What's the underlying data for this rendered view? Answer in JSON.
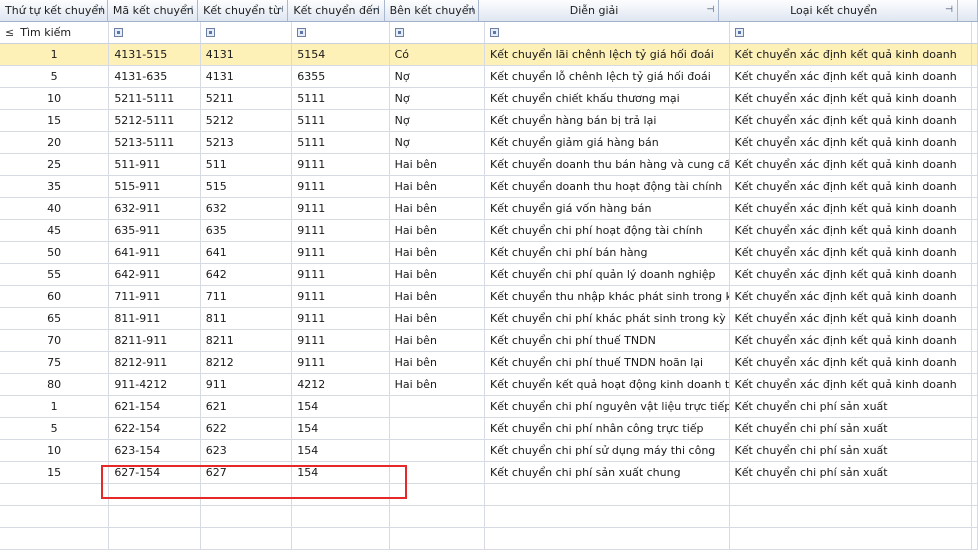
{
  "columns": [
    "Thứ tự kết chuyển",
    "Mã kết chuyển",
    "Kết chuyển từ",
    "Kết chuyển đến",
    "Bên kết chuyển",
    "Diễn giải",
    "Loại kết chuyển"
  ],
  "filter": {
    "operator": "≤",
    "placeholder": "Tìm kiếm"
  },
  "rows": [
    {
      "order": "1",
      "code": "4131-515",
      "from": "4131",
      "to": "5154",
      "side": "Có",
      "desc": "Kết chuyển lãi chênh lệch tỷ giá hối đoái",
      "type": "Kết chuyển xác định kết quả kinh doanh"
    },
    {
      "order": "5",
      "code": "4131-635",
      "from": "4131",
      "to": "6355",
      "side": "Nợ",
      "desc": "Kết chuyển lỗ chênh lệch tỷ giá hối đoái",
      "type": "Kết chuyển xác định kết quả kinh doanh"
    },
    {
      "order": "10",
      "code": "5211-5111",
      "from": "5211",
      "to": "5111",
      "side": "Nợ",
      "desc": "Kết chuyển chiết khấu thương mại",
      "type": "Kết chuyển xác định kết quả kinh doanh"
    },
    {
      "order": "15",
      "code": "5212-5111",
      "from": "5212",
      "to": "5111",
      "side": "Nợ",
      "desc": "Kết chuyển hàng bán bị trả lại",
      "type": "Kết chuyển xác định kết quả kinh doanh"
    },
    {
      "order": "20",
      "code": "5213-5111",
      "from": "5213",
      "to": "5111",
      "side": "Nợ",
      "desc": "Kết chuyển giảm giá hàng bán",
      "type": "Kết chuyển xác định kết quả kinh doanh"
    },
    {
      "order": "25",
      "code": "511-911",
      "from": "511",
      "to": "9111",
      "side": "Hai bên",
      "desc": "Kết chuyển doanh thu bán hàng và cung cấp dị",
      "type": "Kết chuyển xác định kết quả kinh doanh"
    },
    {
      "order": "35",
      "code": "515-911",
      "from": "515",
      "to": "9111",
      "side": "Hai bên",
      "desc": "Kết chuyển doanh thu hoạt động tài chính",
      "type": "Kết chuyển xác định kết quả kinh doanh"
    },
    {
      "order": "40",
      "code": "632-911",
      "from": "632",
      "to": "9111",
      "side": "Hai bên",
      "desc": "Kết chuyển giá vốn hàng bán",
      "type": "Kết chuyển xác định kết quả kinh doanh"
    },
    {
      "order": "45",
      "code": "635-911",
      "from": "635",
      "to": "9111",
      "side": "Hai bên",
      "desc": "Kết chuyển chi phí hoạt động tài chính",
      "type": "Kết chuyển xác định kết quả kinh doanh"
    },
    {
      "order": "50",
      "code": "641-911",
      "from": "641",
      "to": "9111",
      "side": "Hai bên",
      "desc": "Kết chuyển chi phí bán hàng",
      "type": "Kết chuyển xác định kết quả kinh doanh"
    },
    {
      "order": "55",
      "code": "642-911",
      "from": "642",
      "to": "9111",
      "side": "Hai bên",
      "desc": "Kết chuyển chi phí quản lý doanh nghiệp",
      "type": "Kết chuyển xác định kết quả kinh doanh"
    },
    {
      "order": "60",
      "code": "711-911",
      "from": "711",
      "to": "9111",
      "side": "Hai bên",
      "desc": "Kết chuyển thu nhập khác phát sinh trong kỳ",
      "type": "Kết chuyển xác định kết quả kinh doanh"
    },
    {
      "order": "65",
      "code": "811-911",
      "from": "811",
      "to": "9111",
      "side": "Hai bên",
      "desc": "Kết chuyển chi phí khác phát sinh trong kỳ",
      "type": "Kết chuyển xác định kết quả kinh doanh"
    },
    {
      "order": "70",
      "code": "8211-911",
      "from": "8211",
      "to": "9111",
      "side": "Hai bên",
      "desc": "Kết chuyển chi phí thuế TNDN",
      "type": "Kết chuyển xác định kết quả kinh doanh"
    },
    {
      "order": "75",
      "code": "8212-911",
      "from": "8212",
      "to": "9111",
      "side": "Hai bên",
      "desc": "Kết chuyển chi phí thuế TNDN hoãn lại",
      "type": "Kết chuyển xác định kết quả kinh doanh"
    },
    {
      "order": "80",
      "code": "911-4212",
      "from": "911",
      "to": "4212",
      "side": "Hai bên",
      "desc": "Kết chuyển kết quả hoạt động kinh doanh trong",
      "type": "Kết chuyển xác định kết quả kinh doanh"
    },
    {
      "order": "1",
      "code": "621-154",
      "from": "621",
      "to": "154",
      "side": "",
      "desc": "Kết chuyển chi phí nguyên vật liệu trực tiếp",
      "type": "Kết chuyển chi phí sản xuất"
    },
    {
      "order": "5",
      "code": "622-154",
      "from": "622",
      "to": "154",
      "side": "",
      "desc": "Kết chuyển chi phí nhân công trực tiếp",
      "type": "Kết chuyển chi phí sản xuất"
    },
    {
      "order": "10",
      "code": "623-154",
      "from": "623",
      "to": "154",
      "side": "",
      "desc": "Kết chuyển chi phí sử dụng máy thi công",
      "type": "Kết chuyển chi phí sản xuất"
    },
    {
      "order": "15",
      "code": "627-154",
      "from": "627",
      "to": "154",
      "side": "",
      "desc": "Kết chuyển chi phí sản xuất chung",
      "type": "Kết chuyển chi phí sản xuất"
    }
  ],
  "empty_rows": 3,
  "colors": {
    "selected_row": "#fdf1b8",
    "highlight_box": "#e5282a",
    "header_top": "#fdfdfe",
    "header_bottom": "#dfe6f1"
  }
}
